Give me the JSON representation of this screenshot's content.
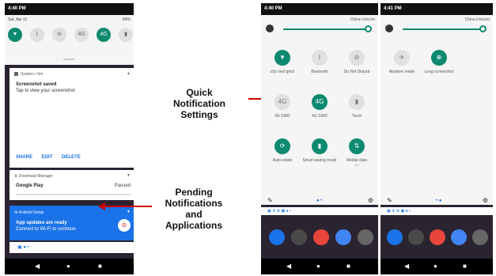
{
  "phone1": {
    "status_time": "4:40 PM",
    "date": "Sat, Apr 11",
    "battery": "84%",
    "qs_icons": [
      "wifi-icon",
      "bluetooth-icon",
      "do-not-disturb-icon",
      "4g-icon",
      "4g-icon",
      "torch-icon"
    ],
    "qs_icon_labels": [
      "",
      "",
      "",
      "4G",
      "4G",
      ""
    ],
    "screenshot_card": {
      "source": "System • 5m",
      "title": "Screenshot saved",
      "subtitle": "Tap to view your screenshot",
      "actions": [
        "SHARE",
        "EDIT",
        "DELETE"
      ]
    },
    "download_card": {
      "source": "Download Manager",
      "title": "Google Play",
      "status": "Paused"
    },
    "setup_card": {
      "source": "Android Setup",
      "title": "App updates are ready",
      "subtitle": "Connect to Wi-Fi to continue"
    }
  },
  "annotations": {
    "quick": [
      "Quick",
      "Notification",
      "Settings"
    ],
    "pending": [
      "Pending",
      "Notifications",
      "and",
      "Applications"
    ]
  },
  "phone2": {
    "status_time": "4:40 PM",
    "carrier": "China Unicom",
    "tiles": [
      {
        "label": "cfzz test gmcl",
        "icon": "wifi-icon",
        "on": true
      },
      {
        "label": "Bluetooth",
        "icon": "bluetooth-icon",
        "on": false
      },
      {
        "label": "Do Not Disturb",
        "icon": "do-not-disturb-icon",
        "on": false
      },
      {
        "label": "4G SIM1",
        "icon": "4g-icon",
        "on": false
      },
      {
        "label": "4G SIM2",
        "icon": "4g-icon",
        "on": true
      },
      {
        "label": "Torch",
        "icon": "torch-icon",
        "on": false
      },
      {
        "label": "Auto-rotate",
        "icon": "rotate-icon",
        "on": true
      },
      {
        "label": "Smart saving mode",
        "icon": "battery-icon",
        "on": true
      },
      {
        "label": "Mobile data",
        "sub": "4G",
        "icon": "data-icon",
        "on": true
      }
    ]
  },
  "phone3": {
    "status_time": "4:41 PM",
    "carrier": "China Unicom",
    "tiles": [
      {
        "label": "Airplane mode",
        "icon": "airplane-icon",
        "on": false
      },
      {
        "label": "Long screenshot",
        "icon": "screenshot-icon",
        "on": true
      }
    ]
  }
}
